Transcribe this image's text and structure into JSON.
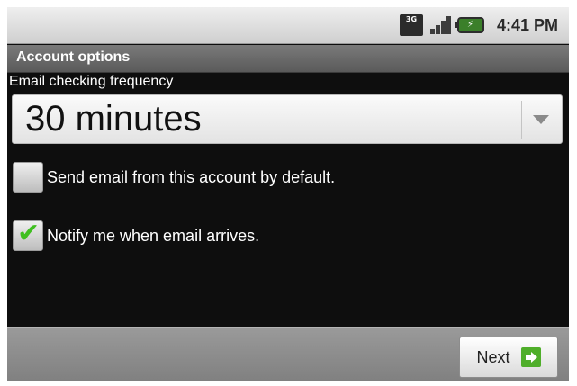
{
  "status_bar": {
    "time": "4:41 PM",
    "network_label": "3G",
    "icons": [
      "network-3g-icon",
      "signal-icon",
      "battery-charging-icon"
    ],
    "battery_color": "#3b7f2a"
  },
  "screen": {
    "title": "Account options"
  },
  "frequency": {
    "label": "Email checking frequency",
    "value": "30 minutes"
  },
  "options": [
    {
      "label": "Send email from this account by default.",
      "checked": false
    },
    {
      "label": "Notify me when email arrives.",
      "checked": true
    }
  ],
  "footer": {
    "next_label": "Next",
    "next_icon": "arrow-right-icon",
    "accent_color": "#4fae2a"
  }
}
